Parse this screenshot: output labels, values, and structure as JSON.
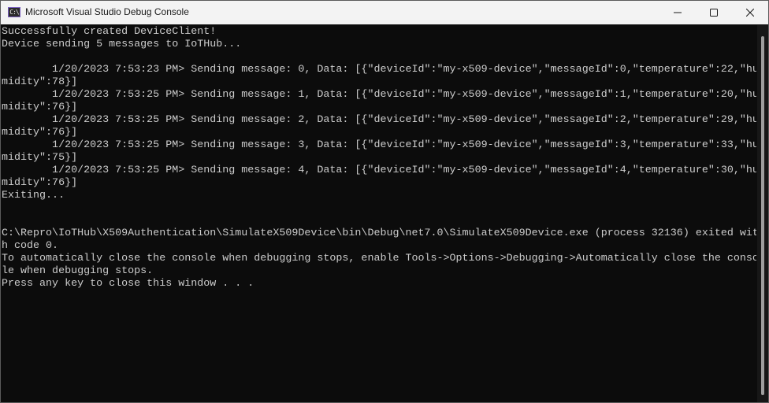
{
  "window": {
    "title": "Microsoft Visual Studio Debug Console",
    "icon_text": "C:\\",
    "icon_name": "console-app-icon",
    "controls": {
      "minimize": "minimize-icon",
      "maximize": "maximize-icon",
      "close": "close-icon"
    }
  },
  "console": {
    "lines": [
      "Successfully created DeviceClient!",
      "Device sending 5 messages to IoTHub...",
      "",
      "        1/20/2023 7:53:23 PM> Sending message: 0, Data: [{\"deviceId\":\"my-x509-device\",\"messageId\":0,\"temperature\":22,\"hu",
      "midity\":78}]",
      "        1/20/2023 7:53:25 PM> Sending message: 1, Data: [{\"deviceId\":\"my-x509-device\",\"messageId\":1,\"temperature\":20,\"hu",
      "midity\":76}]",
      "        1/20/2023 7:53:25 PM> Sending message: 2, Data: [{\"deviceId\":\"my-x509-device\",\"messageId\":2,\"temperature\":29,\"hu",
      "midity\":76}]",
      "        1/20/2023 7:53:25 PM> Sending message: 3, Data: [{\"deviceId\":\"my-x509-device\",\"messageId\":3,\"temperature\":33,\"hu",
      "midity\":75}]",
      "        1/20/2023 7:53:25 PM> Sending message: 4, Data: [{\"deviceId\":\"my-x509-device\",\"messageId\":4,\"temperature\":30,\"hu",
      "midity\":76}]",
      "Exiting...",
      "",
      "",
      "C:\\Repro\\IoTHub\\X509Authentication\\SimulateX509Device\\bin\\Debug\\net7.0\\SimulateX509Device.exe (process 32136) exited wit",
      "h code 0.",
      "To automatically close the console when debugging stops, enable Tools->Options->Debugging->Automatically close the conso",
      "le when debugging stops.",
      "Press any key to close this window . . ."
    ]
  },
  "colors": {
    "background": "#0c0c0c",
    "foreground": "#cccccc",
    "titlebar": "#f3f3f3"
  }
}
